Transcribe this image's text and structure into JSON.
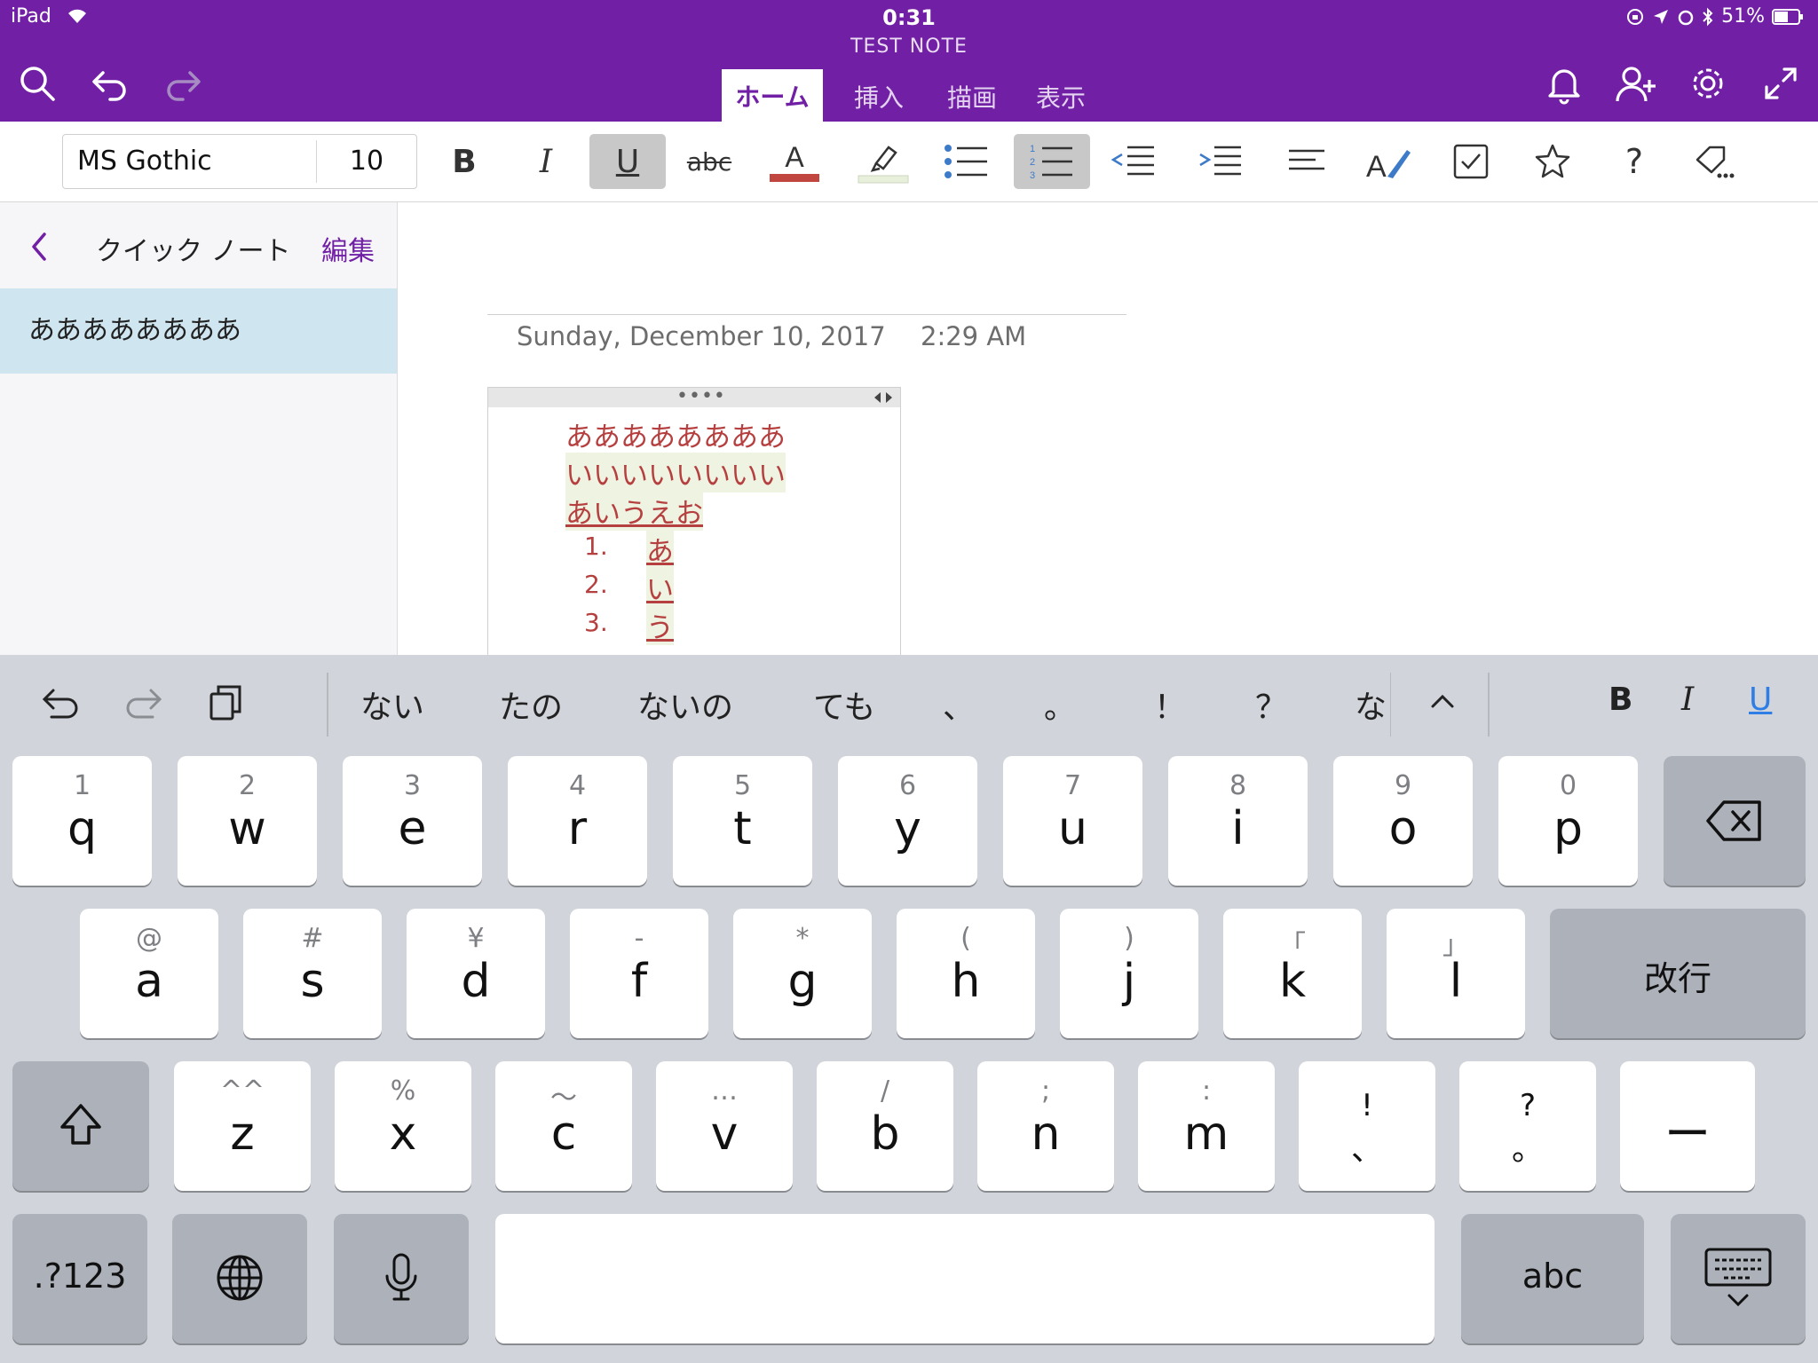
{
  "status_bar": {
    "device": "iPad",
    "time": "0:31",
    "battery": "51%"
  },
  "note_title": "TEST NOTE",
  "tabs": [
    {
      "label": "ホーム",
      "active": true
    },
    {
      "label": "挿入"
    },
    {
      "label": "描画"
    },
    {
      "label": "表示"
    }
  ],
  "ribbon": {
    "font_name": "MS Gothic",
    "font_size": "10",
    "bold": "B",
    "italic": "I",
    "underline": "U",
    "strike": "abc",
    "font_color_glyph": "A",
    "help": "?"
  },
  "colors": {
    "brand": "#7120a5",
    "note_text": "#b5403f",
    "highlight": "#eef3e2",
    "font_color": "#c0463f"
  },
  "sidebar": {
    "section": "クイック ノート",
    "edit": "編集",
    "pages": [
      {
        "title": "ああああああああ",
        "selected": true
      }
    ]
  },
  "note": {
    "date": "Sunday, December 10, 2017",
    "time": "2:29 AM",
    "handle": "••••",
    "lines": [
      "ああああああああ",
      "いいいいいいいい",
      "あいうえお"
    ],
    "list": [
      {
        "num": "1.",
        "text": "あ"
      },
      {
        "num": "2.",
        "text": "い"
      },
      {
        "num": "3.",
        "text": "う"
      }
    ]
  },
  "keyboard": {
    "suggestions": [
      "ない",
      "たの",
      "ないの",
      "ても",
      "、",
      "。",
      "！",
      "？",
      "な"
    ],
    "format": {
      "bold": "B",
      "italic": "I",
      "underline": "U"
    },
    "row1": [
      {
        "hint": "1",
        "main": "q"
      },
      {
        "hint": "2",
        "main": "w"
      },
      {
        "hint": "3",
        "main": "e"
      },
      {
        "hint": "4",
        "main": "r"
      },
      {
        "hint": "5",
        "main": "t"
      },
      {
        "hint": "6",
        "main": "y"
      },
      {
        "hint": "7",
        "main": "u"
      },
      {
        "hint": "8",
        "main": "i"
      },
      {
        "hint": "9",
        "main": "o"
      },
      {
        "hint": "0",
        "main": "p"
      }
    ],
    "row2": [
      {
        "hint": "@",
        "main": "a"
      },
      {
        "hint": "#",
        "main": "s"
      },
      {
        "hint": "¥",
        "main": "d"
      },
      {
        "hint": "-",
        "main": "f"
      },
      {
        "hint": "*",
        "main": "g"
      },
      {
        "hint": "(",
        "main": "h"
      },
      {
        "hint": ")",
        "main": "j"
      },
      {
        "hint": "「",
        "main": "k"
      },
      {
        "hint": "」",
        "main": "l"
      }
    ],
    "return_label": "改行",
    "row3": [
      {
        "hint": "^^",
        "main": "z"
      },
      {
        "hint": "%",
        "main": "x"
      },
      {
        "hint": "〜",
        "main": "c"
      },
      {
        "hint": "…",
        "main": "v"
      },
      {
        "hint": "/",
        "main": "b"
      },
      {
        "hint": ";",
        "main": "n"
      },
      {
        "hint": ":",
        "main": "m"
      },
      {
        "hint": "!",
        "main": "、"
      },
      {
        "hint": "?",
        "main": "。"
      }
    ],
    "dash": "ー",
    "numbers_label": ".?123",
    "abc_label": "abc"
  }
}
